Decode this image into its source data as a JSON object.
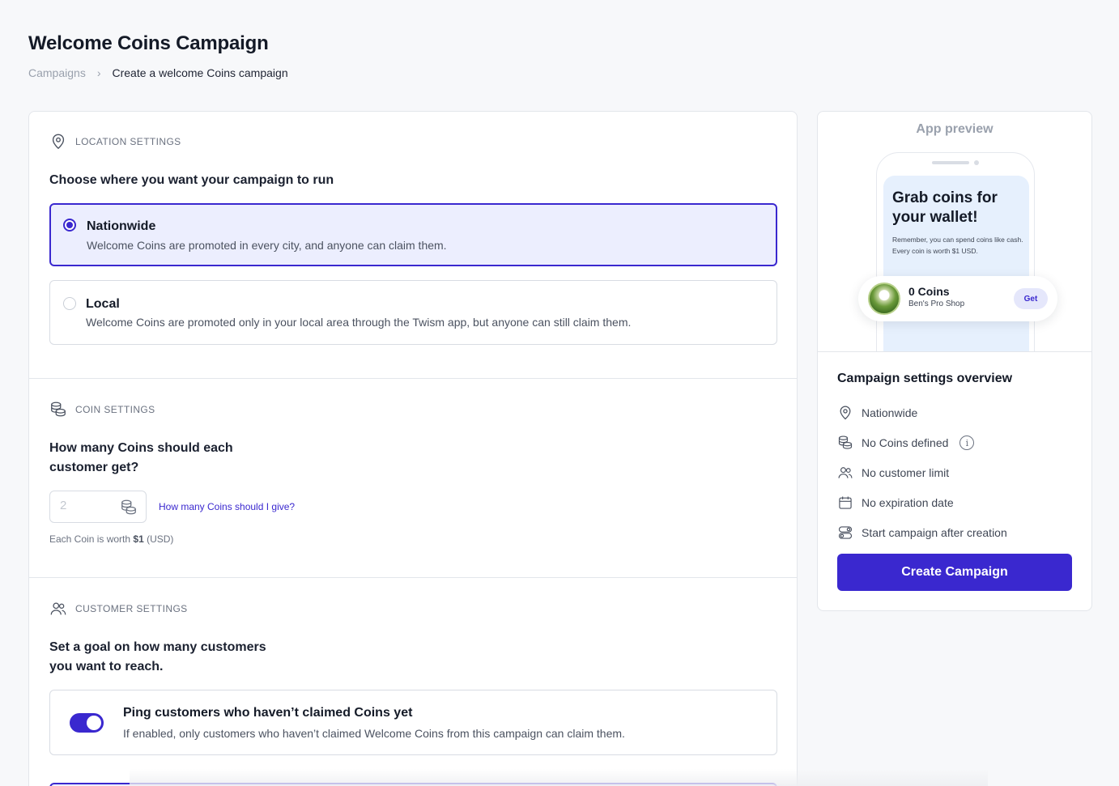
{
  "header": {
    "title": "Welcome Coins Campaign",
    "breadcrumb": {
      "parent": "Campaigns",
      "separator": "›",
      "current": "Create a welcome Coins campaign"
    }
  },
  "location": {
    "section_label": "LOCATION SETTINGS",
    "question": "Choose where you want your campaign to run",
    "options": [
      {
        "title": "Nationwide",
        "description": "Welcome Coins are promoted in every city, and anyone can claim them.",
        "selected": true
      },
      {
        "title": "Local",
        "description": "Welcome Coins are promoted only in your local area through the Twism app, but anyone can still claim them.",
        "selected": false
      }
    ]
  },
  "coins": {
    "section_label": "COIN SETTINGS",
    "question_line1": "How many Coins should each",
    "question_line2": "customer get?",
    "input_placeholder": "2",
    "help_link": "How many Coins should I give?",
    "note_prefix": "Each Coin is worth ",
    "note_value": "$1",
    "note_suffix": " (USD)"
  },
  "customers": {
    "section_label": "CUSTOMER SETTINGS",
    "question_line1": "Set a goal on how many customers",
    "question_line2": "you want to reach.",
    "toggle": {
      "title": "Ping customers who haven’t claimed Coins yet",
      "description": "If enabled, only customers who haven’t claimed Welcome Coins from this campaign can claim them.",
      "enabled": true
    }
  },
  "preview": {
    "label": "App preview",
    "screen_title": "Grab coins for your wallet!",
    "screen_body": "Remember, you can spend coins like cash. Every coin is worth $1 USD.",
    "coin_title": "0 Coins",
    "coin_shop": "Ben's Pro Shop",
    "get_label": "Get"
  },
  "overview": {
    "title": "Campaign settings overview",
    "items": [
      {
        "icon": "location-pin-icon",
        "label": "Nationwide"
      },
      {
        "icon": "coins-icon",
        "label": "No Coins defined"
      },
      {
        "icon": "users-icon",
        "label": "No customer limit"
      },
      {
        "icon": "calendar-icon",
        "label": "No expiration date"
      },
      {
        "icon": "toggles-icon",
        "label": "Start campaign after creation"
      }
    ],
    "create_button": "Create Campaign"
  },
  "colors": {
    "accent": "#3a28cf",
    "selected_bg": "#eceefe",
    "page_bg": "#f7f8fa"
  }
}
